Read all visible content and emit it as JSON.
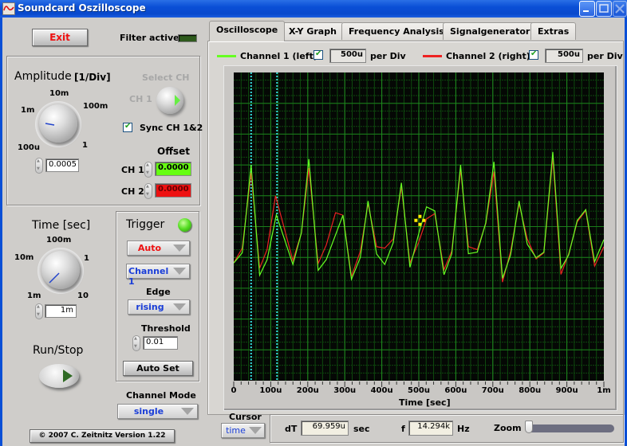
{
  "window": {
    "title": "Soundcard Oszilloscope",
    "controls": [
      "minimize",
      "maximize",
      "close"
    ]
  },
  "left_panel": {
    "exit_label": "Exit",
    "filter_label": "Filter active",
    "amplitude": {
      "title": "Amplitude",
      "unit": "[1/Div]",
      "scale_labels": [
        "100u",
        "1m",
        "10m",
        "100m",
        "1"
      ],
      "value": "0.0005"
    },
    "select_ch": {
      "title": "Select CH",
      "channel": "CH 1"
    },
    "sync_label": "Sync CH 1&2",
    "sync_checked": true,
    "offset": {
      "title": "Offset",
      "ch1_label": "CH 1",
      "ch1_value": "0.0000",
      "ch2_label": "CH 2",
      "ch2_value": "0.0000"
    },
    "time": {
      "title": "Time [sec]",
      "scale_labels": [
        "1m",
        "10m",
        "100m",
        "1",
        "10"
      ],
      "value": "1m"
    },
    "trigger": {
      "title": "Trigger",
      "mode": "Auto",
      "source": "Channel 1",
      "edge_label": "Edge",
      "edge": "rising",
      "threshold_label": "Threshold",
      "threshold": "0.01",
      "autoset_label": "Auto Set"
    },
    "run_stop_label": "Run/Stop",
    "channel_mode": {
      "label": "Channel Mode",
      "value": "single"
    },
    "copyright": "© 2007   C. Zeitnitz Version 1.22"
  },
  "tabs": [
    {
      "label": "Oscilloscope",
      "active": true
    },
    {
      "label": "X-Y Graph",
      "active": false
    },
    {
      "label": "Frequency Analysis",
      "active": false
    },
    {
      "label": "Signalgenerator",
      "active": false
    },
    {
      "label": "Extras",
      "active": false
    }
  ],
  "channels": {
    "ch1": {
      "label": "Channel 1 (left)",
      "checked": true,
      "scale": "500u",
      "unit": "per Div",
      "color": "#66ff22"
    },
    "ch2": {
      "label": "Channel 2 (right)",
      "checked": true,
      "scale": "500u",
      "unit": "per Div",
      "color": "#ee2222"
    }
  },
  "cursor": {
    "label": "Cursor",
    "mode": "time",
    "dt_label": "dT",
    "dt_value": "69.959u",
    "dt_unit": "sec",
    "f_label": "f",
    "f_value": "14.294k",
    "f_unit": "Hz",
    "zoom_label": "Zoom",
    "zoom_level": 0.0
  },
  "colors": {
    "led_filter": "#2e5a1c",
    "led_trigger": "#55dd22",
    "offset_ch1_bg": "#66ff11",
    "offset_ch2_bg": "#ee1111",
    "cursor_line": "#33dddd",
    "grid_major": "#1f8a1f",
    "grid_minor": "#0e4a0e"
  },
  "chart_data": {
    "type": "line",
    "title": "",
    "xlabel": "Time [sec]",
    "ylabel": "",
    "x_tick_labels": [
      "0",
      "100u",
      "200u",
      "300u",
      "400u",
      "500u",
      "600u",
      "700u",
      "800u",
      "900u",
      "1m"
    ],
    "xlim": [
      0,
      0.001
    ],
    "ylim_div": [
      -5,
      5
    ],
    "grid": true,
    "cursors_x": [
      4.7e-05,
      0.000117
    ],
    "marker": {
      "x": 0.000503,
      "y_div": 0.2
    },
    "series": [
      {
        "name": "Channel 1 (left)",
        "color": "#66ff22",
        "x": [
          0,
          2.3e-05,
          4.7e-05,
          7e-05,
          9e-05,
          0.000115,
          0.00016,
          0.000183,
          0.000203,
          0.000228,
          0.00025,
          0.000295,
          0.000318,
          0.000342,
          0.000363,
          0.000386,
          0.000408,
          0.000431,
          0.000453,
          0.000476,
          0.0005,
          0.000521,
          0.000543,
          0.000568,
          0.000589,
          0.000613,
          0.000634,
          0.000658,
          0.000681,
          0.000703,
          0.000726,
          0.000748,
          0.000771,
          0.000793,
          0.000817,
          0.000838,
          0.000862,
          0.000884,
          0.000905,
          0.000928,
          0.000951,
          0.000975,
          0.001
        ],
        "y_div": [
          -1.18,
          -0.85,
          2.0,
          -1.58,
          -1.08,
          0.38,
          -1.23,
          -0.2,
          2.19,
          -1.42,
          -1.07,
          0.37,
          -1.71,
          -1.0,
          0.83,
          -0.89,
          -1.23,
          -0.52,
          1.42,
          -1.32,
          -0.22,
          0.64,
          0.51,
          -1.56,
          -0.89,
          2.0,
          -0.88,
          -0.83,
          0.13,
          2.1,
          -1.68,
          -0.92,
          0.83,
          -0.57,
          -1.01,
          -0.83,
          2.42,
          -1.36,
          -0.92,
          0.2,
          0.55,
          -1.14,
          -0.42
        ]
      },
      {
        "name": "Channel 2 (right)",
        "color": "#ee2222",
        "x": [
          0,
          2.3e-05,
          4.7e-05,
          7e-05,
          9e-05,
          0.000113,
          0.00016,
          0.000183,
          0.000203,
          0.000228,
          0.00025,
          0.000275,
          0.000295,
          0.000318,
          0.000342,
          0.000363,
          0.000386,
          0.000408,
          0.000431,
          0.000453,
          0.000476,
          0.0005,
          0.000521,
          0.000543,
          0.000568,
          0.000589,
          0.000613,
          0.000634,
          0.000658,
          0.000681,
          0.000703,
          0.000726,
          0.000748,
          0.000771,
          0.000793,
          0.000817,
          0.000838,
          0.000862,
          0.000884,
          0.000905,
          0.000928,
          0.000951,
          0.000975,
          0.001
        ],
        "y_div": [
          -1.18,
          -0.7,
          1.75,
          -1.35,
          -0.75,
          1.0,
          -1.1,
          -0.2,
          1.9,
          -1.2,
          -0.6,
          0.45,
          0.37,
          -1.62,
          -0.8,
          0.75,
          -0.65,
          -0.7,
          -0.4,
          1.3,
          -1.18,
          -0.5,
          0.25,
          0.42,
          -1.4,
          -0.8,
          1.85,
          -0.65,
          -0.75,
          0.1,
          1.78,
          -1.8,
          -0.8,
          0.75,
          -0.4,
          -1.05,
          -0.85,
          2.25,
          -1.55,
          -0.88,
          0.15,
          0.52,
          -1.28,
          -0.65
        ]
      }
    ]
  }
}
